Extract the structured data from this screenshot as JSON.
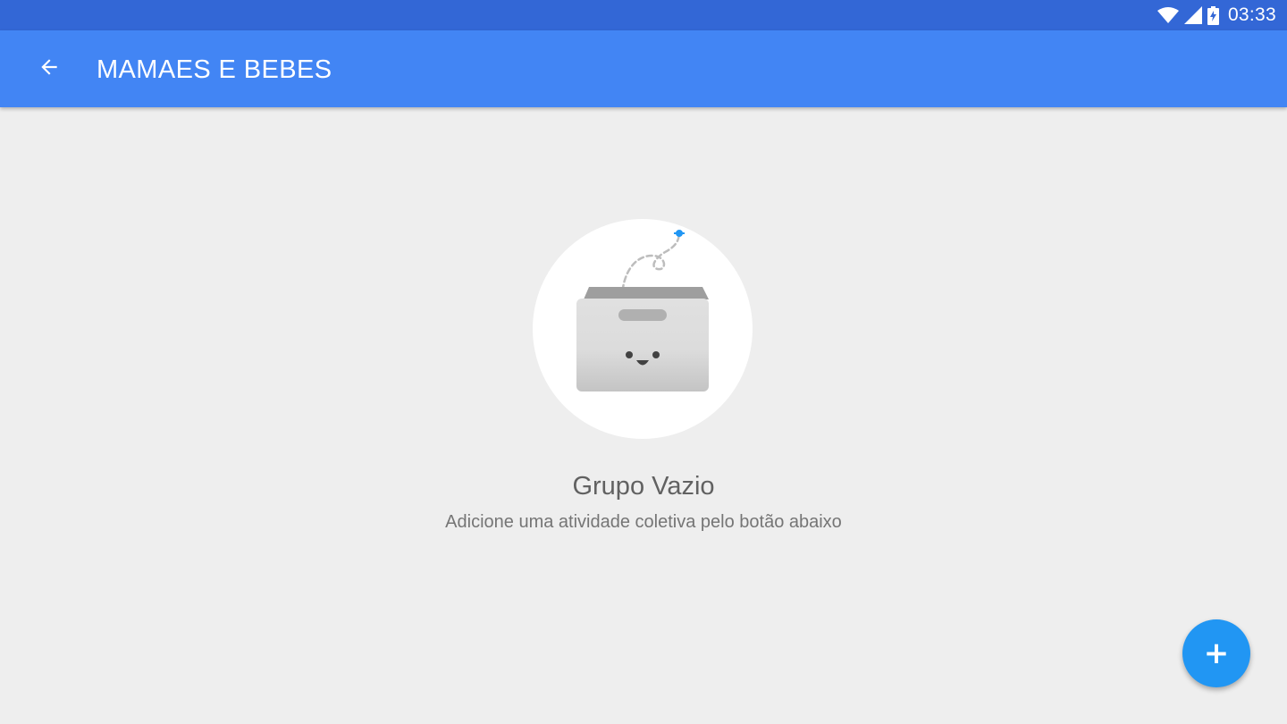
{
  "status_bar": {
    "time": "03:33",
    "icons": [
      "wifi-icon",
      "cell-signal-icon",
      "battery-charging-icon"
    ]
  },
  "app_bar": {
    "title": "MAMAES E BEBES",
    "back_icon": "arrow-back-icon"
  },
  "empty_state": {
    "illustration": "empty-box-icon",
    "title": "Grupo Vazio",
    "subtitle": "Adicione uma atividade coletiva pelo botão abaixo"
  },
  "fab": {
    "icon": "add-icon",
    "label": "+"
  },
  "colors": {
    "status_bar": "#3367d6",
    "app_bar": "#4285f4",
    "background": "#eeeeee",
    "fab": "#2196f3"
  }
}
